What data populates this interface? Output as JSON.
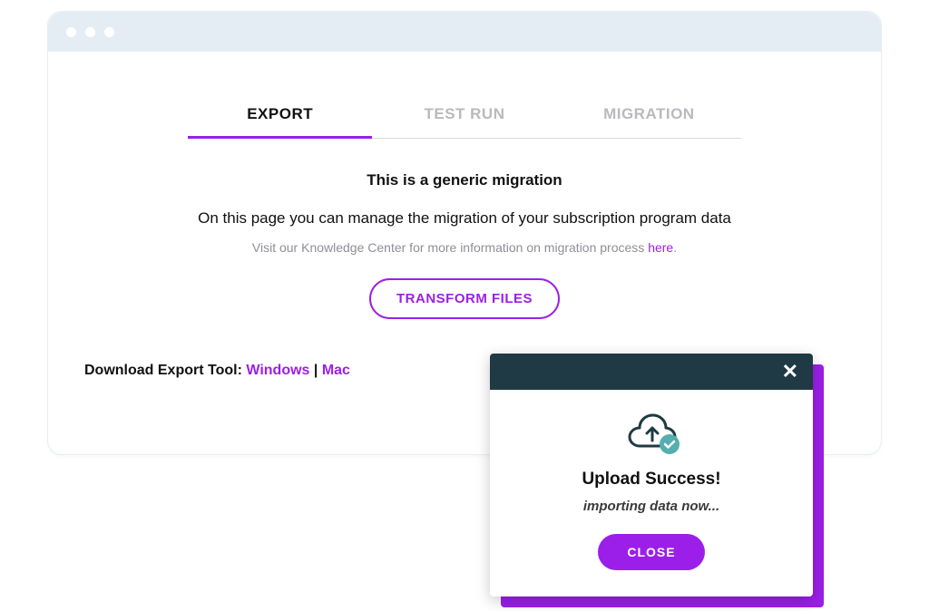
{
  "colors": {
    "accent": "#9b1fe8",
    "modal_header": "#1f3a44",
    "check": "#55aeb0"
  },
  "tabs": [
    {
      "label": "EXPORT",
      "active": true
    },
    {
      "label": "TEST RUN",
      "active": false
    },
    {
      "label": "MIGRATION",
      "active": false
    }
  ],
  "content": {
    "title": "This is a generic migration",
    "subtitle": "On this page you can manage the migration of your subscription program data",
    "help_prefix": "Visit our Knowledge Center for more information on migration process ",
    "help_link": "here",
    "help_suffix": ".",
    "transform_button": "TRANSFORM FILES"
  },
  "download": {
    "label": "Download Export Tool: ",
    "windows": "Windows",
    "separator": " | ",
    "mac": "Mac"
  },
  "modal": {
    "title": "Upload Success!",
    "subtitle": "importing data now...",
    "close_button": "CLOSE",
    "close_icon": "✕"
  }
}
